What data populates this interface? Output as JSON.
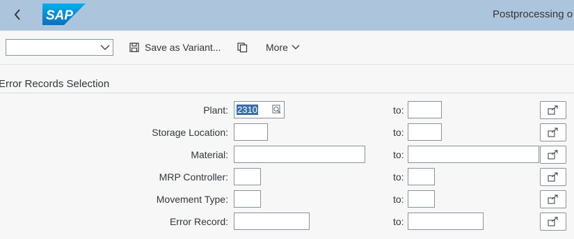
{
  "shell": {
    "title": "Postprocessing o",
    "logo_text": "SAP",
    "colors": {
      "header_bg": "#adc5dc",
      "logo_blue": "#1a7cc9"
    }
  },
  "toolbar": {
    "variant_value": "",
    "save_variant_label": "Save as Variant...",
    "more_label": "More"
  },
  "section": {
    "title": "Error Records Selection"
  },
  "fields": [
    {
      "label": "Plant:",
      "from": "2310",
      "to_label": "to:",
      "to": ""
    },
    {
      "label": "Storage Location:",
      "from": "",
      "to_label": "to:",
      "to": ""
    },
    {
      "label": "Material:",
      "from": "",
      "to_label": "to:",
      "to": ""
    },
    {
      "label": "MRP Controller:",
      "from": "",
      "to_label": "to:",
      "to": ""
    },
    {
      "label": "Movement Type:",
      "from": "",
      "to_label": "to:",
      "to": ""
    },
    {
      "label": "Error Record:",
      "from": "",
      "to_label": "to:",
      "to": ""
    }
  ]
}
